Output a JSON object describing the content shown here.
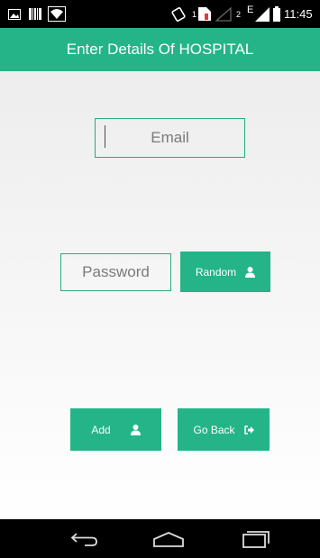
{
  "status_bar": {
    "sim_slot_1": "1",
    "sim_slot_2": "2",
    "network_type": "E",
    "time": "11:45",
    "icons": [
      "image-icon",
      "barcode-icon",
      "wifi-icon",
      "vibrate-icon",
      "sim-alert-icon",
      "no-signal-icon",
      "signal-icon",
      "battery-icon"
    ]
  },
  "app_bar": {
    "title": "Enter Details Of HOSPITAL"
  },
  "form": {
    "email_placeholder": "Email",
    "email_value": "",
    "password_placeholder": "Password",
    "password_value": "",
    "random_label": "Random",
    "add_label": "Add",
    "go_back_label": "Go Back"
  },
  "nav_bar": {
    "icons": [
      "back-icon",
      "home-icon",
      "recent-apps-icon"
    ]
  },
  "colors": {
    "accent": "#24b487",
    "border": "#2aa97f",
    "status_bar": "#000000",
    "background_top": "#ededed",
    "background_bottom": "#ffffff"
  }
}
